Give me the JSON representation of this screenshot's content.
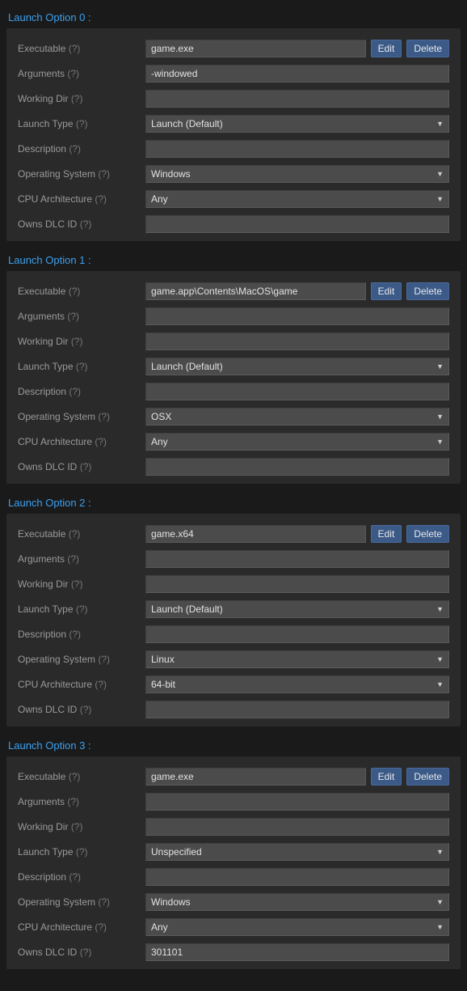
{
  "buttons": {
    "edit": "Edit",
    "delete": "Delete"
  },
  "field_labels": {
    "executable": "Executable",
    "arguments": "Arguments",
    "working_dir": "Working Dir",
    "launch_type": "Launch Type",
    "description": "Description",
    "operating_system": "Operating System",
    "cpu_architecture": "CPU Architecture",
    "owns_dlc_id": "Owns DLC ID",
    "help": "(?)"
  },
  "sections": [
    {
      "title": "Launch Option 0 :",
      "executable": "game.exe",
      "arguments": "-windowed",
      "working_dir": "",
      "launch_type": "Launch (Default)",
      "description": "",
      "operating_system": "Windows",
      "cpu_architecture": "Any",
      "owns_dlc_id": ""
    },
    {
      "title": "Launch Option 1 :",
      "executable": "game.app\\Contents\\MacOS\\game",
      "arguments": "",
      "working_dir": "",
      "launch_type": "Launch (Default)",
      "description": "",
      "operating_system": "OSX",
      "cpu_architecture": "Any",
      "owns_dlc_id": ""
    },
    {
      "title": "Launch Option 2 :",
      "executable": "game.x64",
      "arguments": "",
      "working_dir": "",
      "launch_type": "Launch (Default)",
      "description": "",
      "operating_system": "Linux",
      "cpu_architecture": "64-bit",
      "owns_dlc_id": ""
    },
    {
      "title": "Launch Option 3 :",
      "executable": "game.exe",
      "arguments": "",
      "working_dir": "",
      "launch_type": "Unspecified",
      "description": "",
      "operating_system": "Windows",
      "cpu_architecture": "Any",
      "owns_dlc_id": "301101"
    }
  ]
}
